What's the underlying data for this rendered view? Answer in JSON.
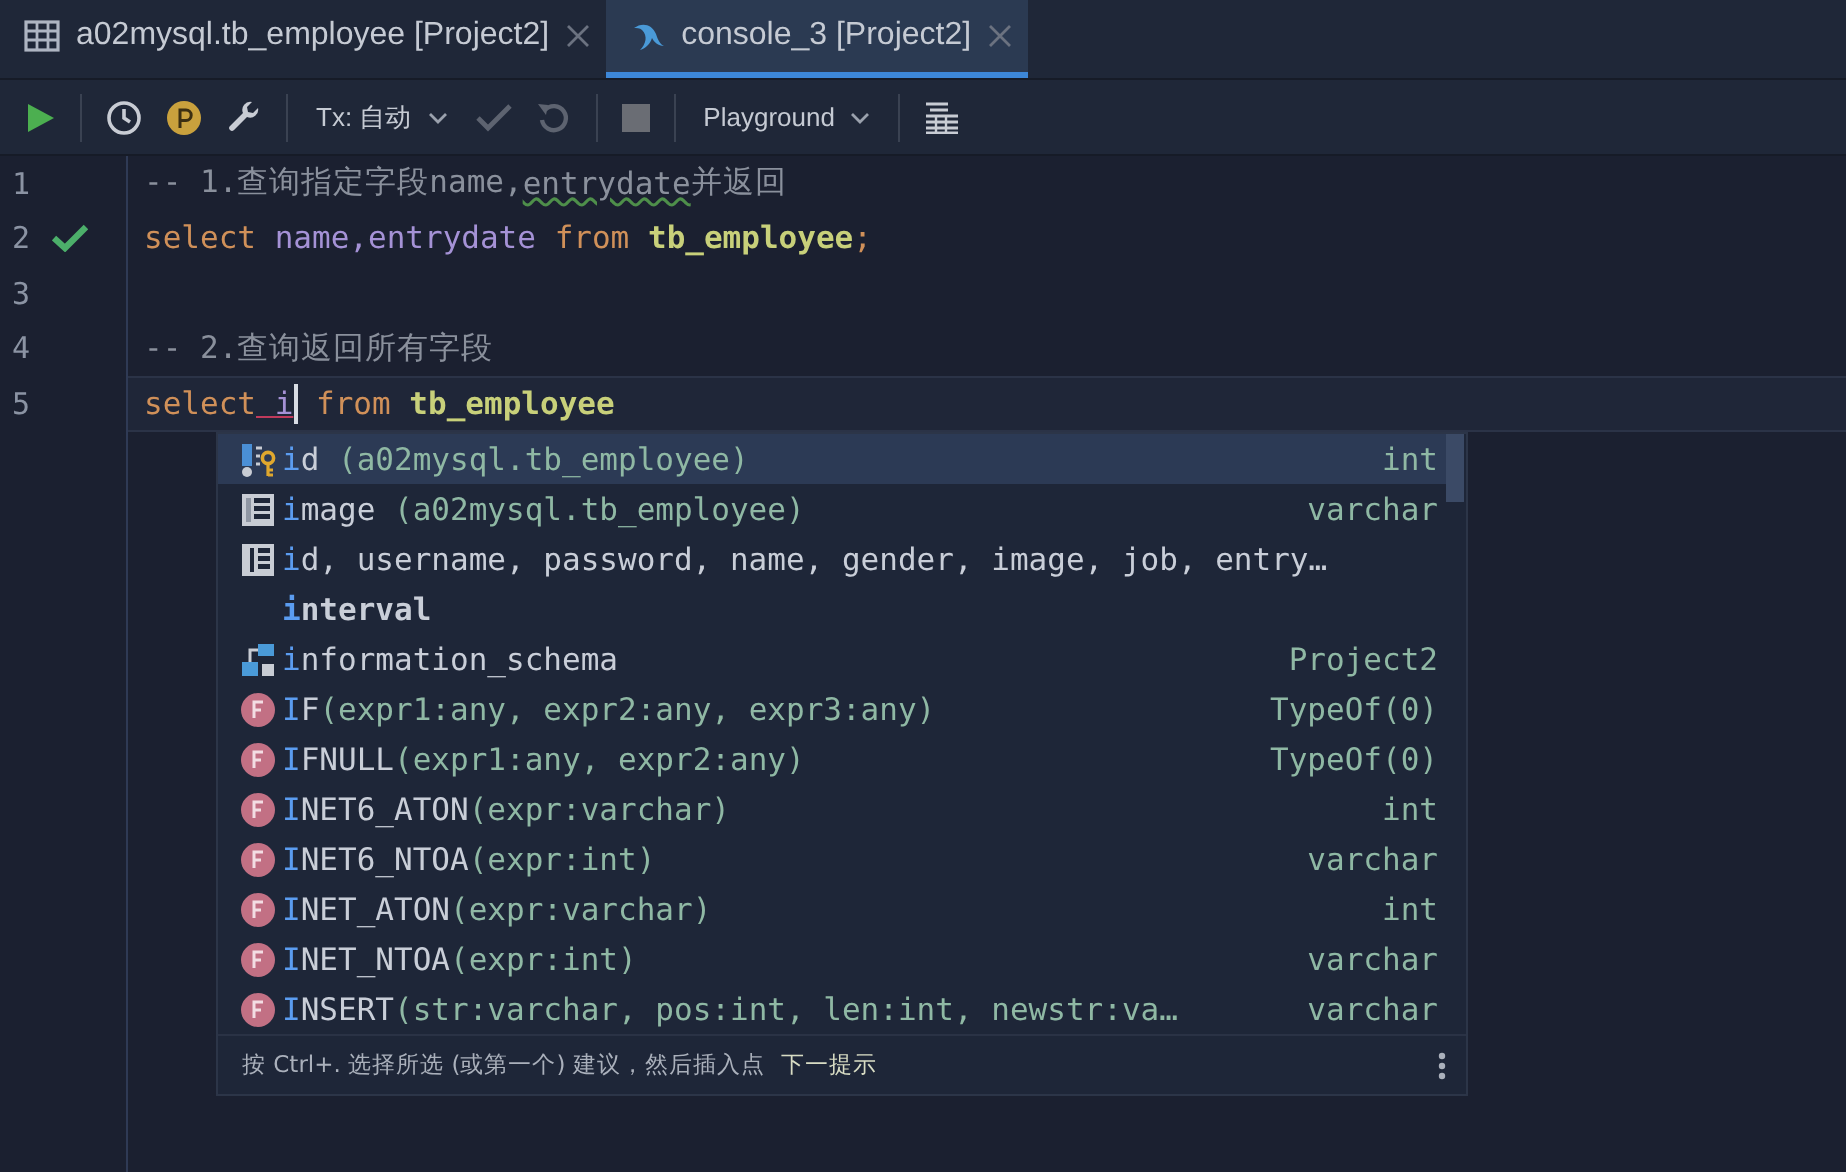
{
  "tabs": [
    {
      "label": "a02mysql.tb_employee [Project2]",
      "kind": "table",
      "selected": false
    },
    {
      "label": "console_3 [Project2]",
      "kind": "console",
      "selected": true
    }
  ],
  "toolbar": {
    "tx_label": "Tx: 自动",
    "schema_label": "Playground"
  },
  "editor": {
    "lines": [
      {
        "number": "1",
        "passed": false,
        "current": false,
        "tokens": [
          {
            "kind": "comment",
            "text": "-- 1.查询指定字段name,"
          },
          {
            "kind": "comment-warn",
            "text": "entrydate"
          },
          {
            "kind": "comment",
            "text": "并返回"
          }
        ]
      },
      {
        "number": "2",
        "passed": true,
        "current": false,
        "tokens": [
          {
            "kind": "keyword",
            "text": "select "
          },
          {
            "kind": "ident",
            "text": "name,entrydate "
          },
          {
            "kind": "keyword",
            "text": "from "
          },
          {
            "kind": "table",
            "text": "tb_employee"
          },
          {
            "kind": "keyword",
            "text": ";"
          }
        ]
      },
      {
        "number": "3",
        "passed": false,
        "current": false
      },
      {
        "number": "4",
        "passed": false,
        "current": false,
        "tokens": [
          {
            "kind": "comment",
            "text": "-- 2.查询返回所有字段"
          }
        ]
      },
      {
        "number": "5",
        "passed": false,
        "current": true,
        "tokens": [
          {
            "kind": "keyword",
            "text": "select"
          },
          {
            "kind": "error",
            "text": " i"
          },
          {
            "kind": "caret"
          },
          {
            "kind": "keyword",
            "text": " from "
          },
          {
            "kind": "table",
            "text": "tb_employee"
          }
        ]
      }
    ]
  },
  "completion": {
    "items": [
      {
        "kind": "key-column",
        "match": "i",
        "text": "d",
        "detail": " (a02mysql.tb_employee)",
        "type": "int",
        "selected": true
      },
      {
        "kind": "column",
        "match": "i",
        "text": "mage",
        "detail": " (a02mysql.tb_employee)",
        "type": "varchar",
        "selected": false
      },
      {
        "kind": "columns",
        "match": "i",
        "text": "d, username, password, name, gender, image, job, entry…",
        "selected": false
      },
      {
        "kind": "keyword",
        "match": "i",
        "text": "nterval",
        "selected": false
      },
      {
        "kind": "schema",
        "match": "i",
        "text": "nformation_schema",
        "type": "Project2",
        "selected": false
      },
      {
        "kind": "function",
        "match": "I",
        "text": "F",
        "detail": "(expr1:any, expr2:any, expr3:any)",
        "type": "TypeOf(0)",
        "selected": false
      },
      {
        "kind": "function",
        "match": "I",
        "text": "FNULL",
        "detail": "(expr1:any, expr2:any)",
        "type": "TypeOf(0)",
        "selected": false
      },
      {
        "kind": "function",
        "match": "I",
        "text": "NET6_ATON",
        "detail": "(expr:varchar)",
        "type": "int",
        "selected": false
      },
      {
        "kind": "function",
        "match": "I",
        "text": "NET6_NTOA",
        "detail": "(expr:int)",
        "type": "varchar",
        "selected": false
      },
      {
        "kind": "function",
        "match": "I",
        "text": "NET_ATON",
        "detail": "(expr:varchar)",
        "type": "int",
        "selected": false
      },
      {
        "kind": "function",
        "match": "I",
        "text": "NET_NTOA",
        "detail": "(expr:int)",
        "type": "varchar",
        "selected": false
      },
      {
        "kind": "function",
        "match": "I",
        "text": "NSERT",
        "detail": "(str:varchar, pos:int, len:int, newstr:va…",
        "type": "varchar",
        "selected": false
      }
    ],
    "hint": "按 Ctrl+. 选择所选 (或第一个) 建议，然后插入点",
    "hint_link": "下一提示"
  }
}
